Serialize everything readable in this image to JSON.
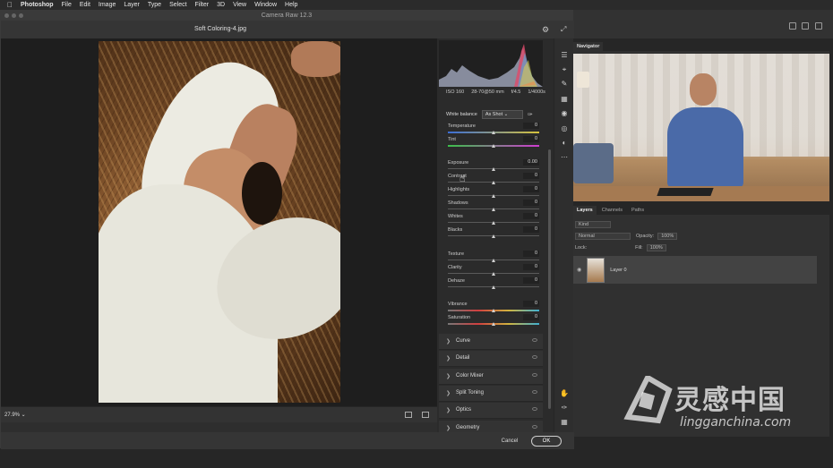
{
  "menubar": {
    "items": [
      "Photoshop",
      "File",
      "Edit",
      "Image",
      "Layer",
      "Type",
      "Select",
      "Filter",
      "3D",
      "View",
      "Window",
      "Help"
    ]
  },
  "window": {
    "title": "Camera Raw 12.3",
    "filename": "Soft Coloring-4.jpg"
  },
  "camera_info": [
    "ISO 160",
    "28-70@50 mm",
    "f/4.5",
    "1/4000s"
  ],
  "white_balance": {
    "label": "White balance",
    "value": "As Shot"
  },
  "sliders": [
    {
      "label": "Temperature",
      "value": "0",
      "pos": 0.5
    },
    {
      "label": "Tint",
      "value": "0",
      "pos": 0.5
    },
    {
      "label": "Exposure",
      "value": "0.00",
      "pos": 0.5
    },
    {
      "label": "Contrast",
      "value": "0",
      "pos": 0.5
    },
    {
      "label": "Highlights",
      "value": "0",
      "pos": 0.5
    },
    {
      "label": "Shadows",
      "value": "0",
      "pos": 0.5
    },
    {
      "label": "Whites",
      "value": "0",
      "pos": 0.5
    },
    {
      "label": "Blacks",
      "value": "0",
      "pos": 0.5
    },
    {
      "label": "Texture",
      "value": "0",
      "pos": 0.5
    },
    {
      "label": "Clarity",
      "value": "0",
      "pos": 0.5
    },
    {
      "label": "Dehaze",
      "value": "0",
      "pos": 0.5
    },
    {
      "label": "Vibrance",
      "value": "0",
      "pos": 0.5
    },
    {
      "label": "Saturation",
      "value": "0",
      "pos": 0.5
    }
  ],
  "sections": [
    "Curve",
    "Detail",
    "Color Mixer",
    "Split Toning",
    "Optics",
    "Geometry"
  ],
  "zoom": "27.9%",
  "buttons": {
    "cancel": "Cancel",
    "ok": "OK"
  },
  "navigator": {
    "tab": "Navigator"
  },
  "layers": {
    "tabs": [
      "Layers",
      "Channels",
      "Paths"
    ],
    "kind": "Kind",
    "blend_mode": "Normal",
    "opacity_label": "Opacity:",
    "opacity": "100%",
    "lock_label": "Lock:",
    "fill_label": "Fill:",
    "fill": "100%",
    "layer_name": "Layer 0"
  },
  "watermark": {
    "cn": "灵感中国",
    "url": "lingganchina.com"
  },
  "colors": {
    "accent": "#cfcfcf",
    "panel": "#2b2b2b"
  }
}
